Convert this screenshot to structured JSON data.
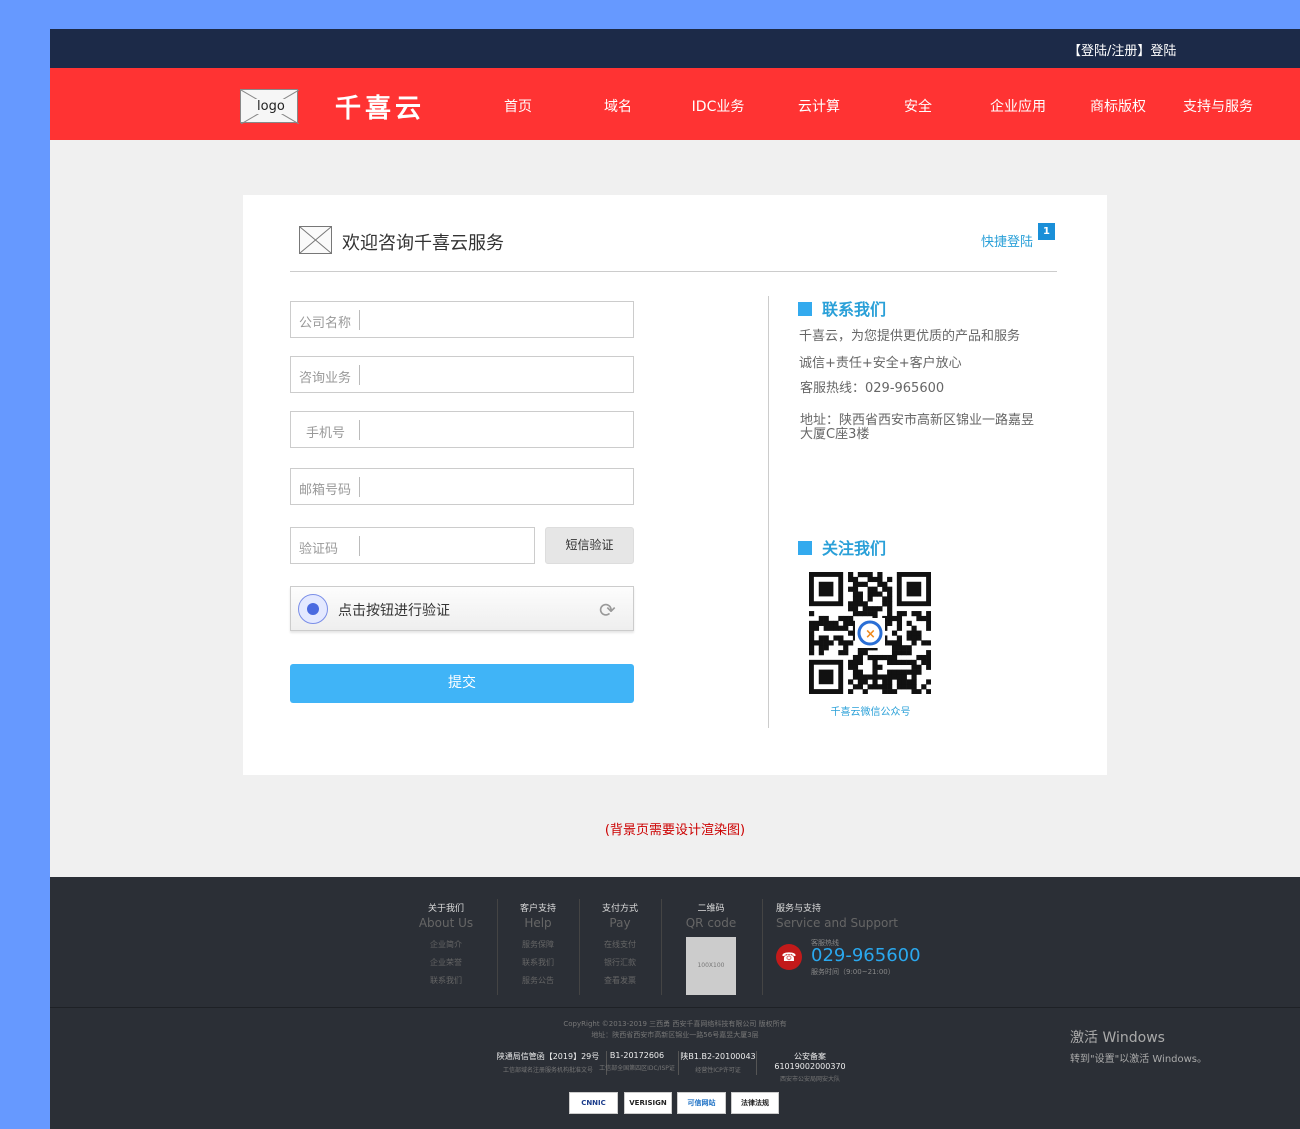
{
  "topbar": {
    "login_text": "【登陆/注册】登陆"
  },
  "nav": {
    "logo_text": "logo",
    "brand": "千喜云",
    "items": [
      "首页",
      "域名",
      "IDC业务",
      "云计算",
      "安全",
      "企业应用",
      "商标版权",
      "支持与服务"
    ]
  },
  "card": {
    "title": "欢迎咨询千喜云服务",
    "quick_login": "快捷登陆",
    "badge": "1",
    "fields": {
      "company": "公司名称",
      "business": "咨询业务",
      "phone": "手机号",
      "email": "邮箱号码",
      "code": "验证码"
    },
    "sms_button": "短信验证",
    "captcha_text": "点击按钮进行验证",
    "submit": "提交",
    "contact": {
      "title": "联系我们",
      "line1": "千喜云，为您提供更优质的产品和服务",
      "line2": "诚信+责任+安全+客户放心",
      "line3": "客服热线：029-965600",
      "line4": "地址：陕西省西安市高新区锦业一路嘉昱大厦C座3楼"
    },
    "follow": {
      "title": "关注我们",
      "qr_caption": "千喜云微信公众号"
    }
  },
  "note": "(背景页需要设计渲染图)",
  "footer": {
    "cols": [
      {
        "h": "关于我们",
        "sub": "About Us",
        "links": [
          "企业简介",
          "企业荣誉",
          "联系我们"
        ]
      },
      {
        "h": "客户支持",
        "sub": "Help",
        "links": [
          "服务保障",
          "联系我们",
          "服务公告"
        ]
      },
      {
        "h": "支付方式",
        "sub": "Pay",
        "links": [
          "在线支付",
          "银行汇款",
          "查看发票"
        ]
      }
    ],
    "qr": {
      "h": "二维码",
      "sub": "QR code",
      "placeholder": "100X100"
    },
    "service": {
      "h": "服务与支持",
      "sub": "Service and Support",
      "hotline_label": "客服热线",
      "phone": "029-965600",
      "hours": "服务时间（9:00~21:00）"
    },
    "copyright": "CopyRight ©2013-2019 三西勇 西安千喜网络科技有限公司 版权所有",
    "address": "地址：陕西省西安市高新区锦业一路56号嘉昱大厦3层",
    "licenses": [
      {
        "a": "陕通局信管函【2019】29号",
        "b": "工信部域名注册服务机构批准文号"
      },
      {
        "a": "B1-20172606",
        "b": "工信部全国第四区IDC/ISP证"
      },
      {
        "a": "陕B1.B2-20100043",
        "b": "经营性ICP许可证"
      },
      {
        "a": "公安备案 61019002000370",
        "b": "西安市公安局网安大队"
      }
    ],
    "badges": [
      "CNNIC",
      "VERISIGN",
      "可信网站",
      "法律法规"
    ]
  },
  "watermark": {
    "line1": "激活 Windows",
    "line2": "转到\"设置\"以激活 Windows。"
  }
}
